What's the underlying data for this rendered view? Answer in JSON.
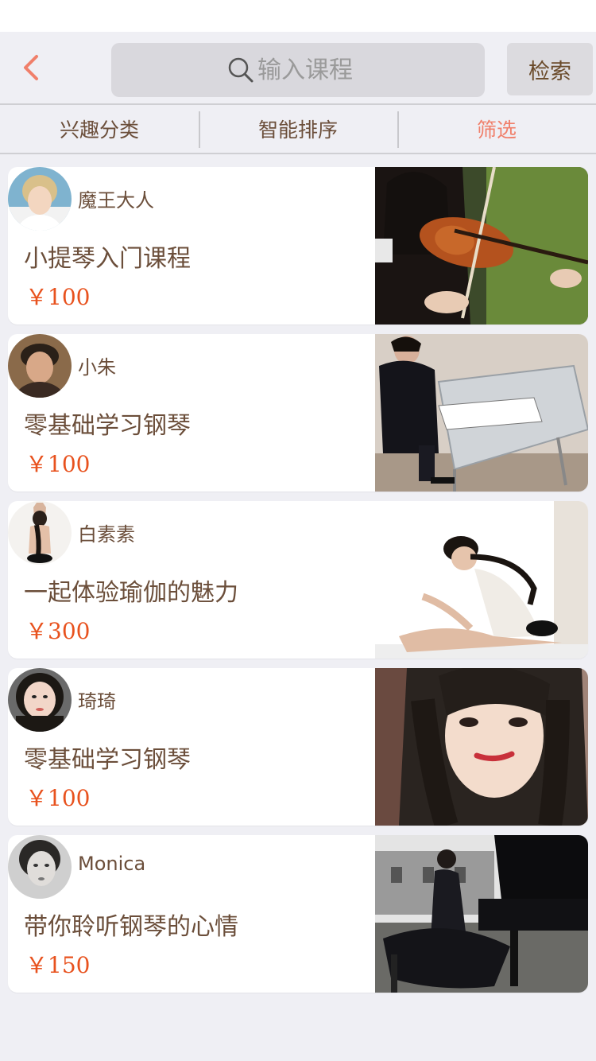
{
  "header": {
    "search_placeholder": "输入课程",
    "search_button_label": "检索"
  },
  "filters": [
    {
      "label": "兴趣分类",
      "active": false
    },
    {
      "label": "智能排序",
      "active": false
    },
    {
      "label": "筛选",
      "active": true
    }
  ],
  "courses": [
    {
      "teacher": "魔王大人",
      "title": "小提琴入门课程",
      "price": "￥100",
      "avatar_icon": "teacher-avatar",
      "thumb_icon": "violin-photo"
    },
    {
      "teacher": "小朱",
      "title": "零基础学习钢琴",
      "price": "￥100",
      "avatar_icon": "teacher-avatar",
      "thumb_icon": "piano-photo"
    },
    {
      "teacher": "白素素",
      "title": "一起体验瑜伽的魅力",
      "price": "￥300",
      "avatar_icon": "teacher-avatar",
      "thumb_icon": "yoga-photo"
    },
    {
      "teacher": "琦琦",
      "title": "零基础学习钢琴",
      "price": "￥100",
      "avatar_icon": "teacher-avatar",
      "thumb_icon": "portrait-photo"
    },
    {
      "teacher": "Monica",
      "title": "带你聆听钢琴的心情",
      "price": "￥150",
      "avatar_icon": "teacher-avatar",
      "thumb_icon": "piano-outdoor-photo"
    }
  ],
  "colors": {
    "accent": "#f07f6a",
    "price": "#e8521e",
    "text": "#6b4e3a",
    "background": "#efeff4"
  }
}
